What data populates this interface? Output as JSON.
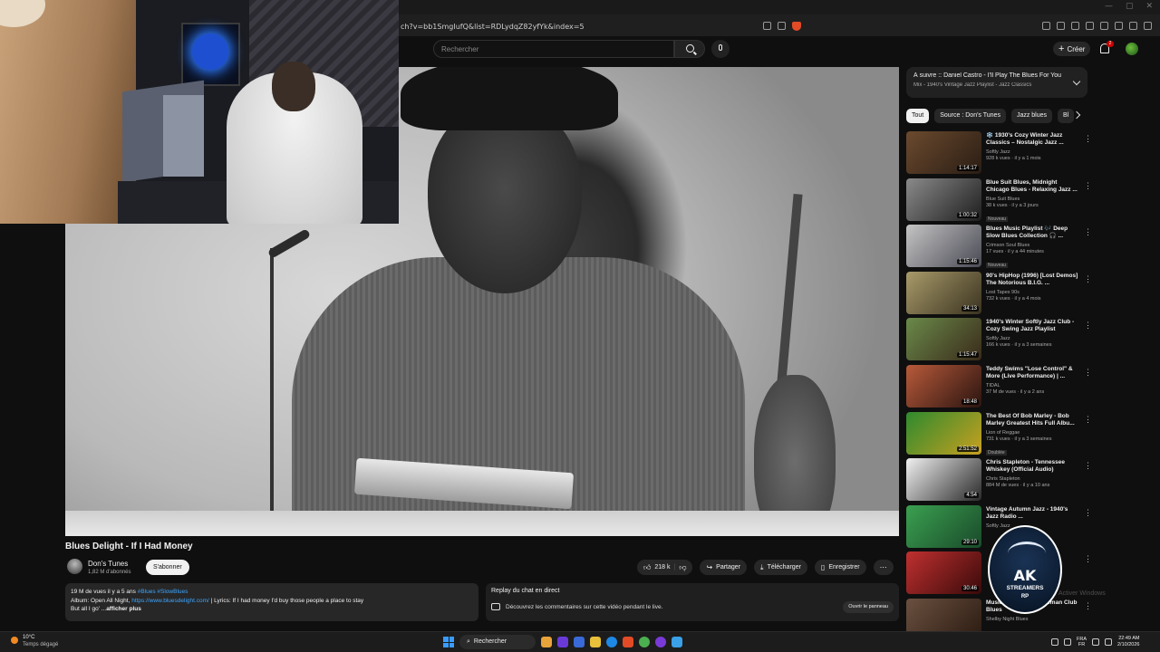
{
  "browser": {
    "url": "ch?v=bb1SmgIufQ&list=RDLydqZ82yfYk&index=5"
  },
  "header": {
    "search_placeholder": "Rechercher",
    "create_label": "Créer",
    "notifications_count": "2"
  },
  "video": {
    "title": "Blues Delight - If I Had Money",
    "channel": "Don's Tunes",
    "subscribers": "1,82 M d'abonnés",
    "subscribe_label": "S'abonner",
    "likes": "218 k",
    "share_label": "Partager",
    "download_label": "Télécharger",
    "save_label": "Enregistrer"
  },
  "description": {
    "stats": "19 M de vues  il y a 5 ans",
    "tags": "#Blues #SlowBlues",
    "line2_prefix": "Album: Open All Night, ",
    "link": "https://www.bluesdelight.com/",
    "line2_suffix": " | Lyrics:  If I had money I'd buy those people a place to stay",
    "line3": "But all I go' ...",
    "more": "afficher plus"
  },
  "live_chat": {
    "title": "Replay du chat en direct",
    "body": "Découvrez les commentaires sur cette vidéo pendant le live.",
    "open_label": "Ouvrir le panneau"
  },
  "playlist": {
    "title": "À suivre :: Daniel Castro - I'll Play The Blues For You",
    "subtitle": "Mix - 1940's Vintage Jazz Playlist - Jazz Classics"
  },
  "chips": [
    "Tout",
    "Source : Don's Tunes",
    "Jazz blues",
    "Bl"
  ],
  "related": [
    {
      "title": "❄️ 1930's Cozy Winter Jazz Classics – Nostalgic Jazz ...",
      "channel": "Softly Jazz",
      "views": "928 k vues · il y a 1 mois",
      "duration": "1:14:17",
      "badge": "",
      "color1": "#6b4a2e",
      "color2": "#2a1d14"
    },
    {
      "title": "Blue Suit Blues, Midnight Chicago Blues - Relaxing Jazz ...",
      "channel": "Blue Suit Blues",
      "views": "38 k vues · il y a 3 jours",
      "duration": "1:00:32",
      "badge": "Nouveau",
      "color1": "#8a8a8a",
      "color2": "#1e1e1e"
    },
    {
      "title": "Blues Music Playlist 🎶 Deep Slow Blues Collection 🎧 ...",
      "channel": "Crimson Soul Blues",
      "views": "17 vues · il y a 44 minutes",
      "duration": "1:15:46",
      "badge": "Nouveau",
      "color1": "#c4c4c4",
      "color2": "#4a4a55"
    },
    {
      "title": "90's HipHop (1996) [Lost Demos] The Notorious B.I.G. ...",
      "channel": "Lost Tapes 90s",
      "views": "732 k vues · il y a 4 mois",
      "duration": "34:13",
      "badge": "",
      "color1": "#a89a6a",
      "color2": "#3a3320"
    },
    {
      "title": "1940's Winter Softly Jazz Club - Cozy Swing Jazz Playlist",
      "channel": "Softly Jazz",
      "views": "166 k vues · il y a 3 semaines",
      "duration": "1:15:47",
      "badge": "",
      "color1": "#6a8a4a",
      "color2": "#3a2a1a"
    },
    {
      "title": "Teddy Swims \"Lose Control\" & More (Live Performance) | ...",
      "channel": "TIDAL",
      "views": "37 M de vues · il y a 2 ans",
      "duration": "18:48",
      "badge": "",
      "color1": "#b85a3a",
      "color2": "#2a1410"
    },
    {
      "title": "The Best Of Bob Marley - Bob Marley Greatest Hits Full Albu...",
      "channel": "Lion of Reggae",
      "views": "731 k vues · il y a 3 semaines",
      "duration": "2:51:52",
      "badge": "Doublée",
      "color1": "#2e8a2e",
      "color2": "#c8a020"
    },
    {
      "title": "Chris Stapleton - Tennessee Whiskey (Official Audio)",
      "channel": "Chris Stapleton",
      "views": "884 M de vues · il y a 10 ans",
      "duration": "4:54",
      "badge": "",
      "color1": "#f0f0f0",
      "color2": "#2a2a2a"
    },
    {
      "title": "Vintage Autumn Jazz - 1940's Jazz Radio ...",
      "channel": "Softly Jazz",
      "views": "",
      "duration": "29:10",
      "badge": "",
      "color1": "#3aa050",
      "color2": "#1a4a2a"
    },
    {
      "title": "",
      "channel": "",
      "views": "",
      "duration": "30:46",
      "badge": "",
      "color1": "#c03030",
      "color2": "#3a0a0a"
    },
    {
      "title": "Music ... Silent | Gentleman Club Blues",
      "channel": "Shelby Night Blues",
      "views": "",
      "duration": "",
      "badge": "",
      "color1": "#6a5040",
      "color2": "#2a1a10"
    }
  ],
  "overlay": {
    "logo_main": "AK",
    "logo_sub": "STREAMERS",
    "logo_rp": "RP",
    "activate_text": "Activer Windows"
  },
  "taskbar": {
    "temp": "10°C",
    "weather": "Temps dégagé",
    "search_label": "Rechercher",
    "lang_line1": "FRA",
    "lang_line2": "FR",
    "time": "22:49 AM",
    "date": "2/10/2026"
  }
}
